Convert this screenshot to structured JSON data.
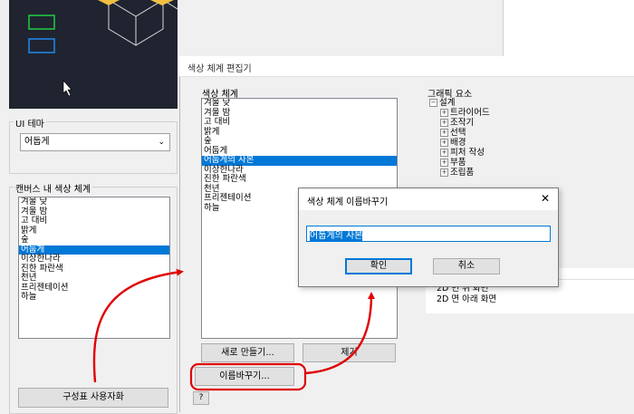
{
  "left_panel": {
    "ui_theme_label": "UI 테마",
    "ui_theme_value": "어둡게",
    "canvas_scheme_label": "캔버스 내 색상 체계",
    "schemes": [
      "겨울 낮",
      "겨울 밤",
      "고 대비",
      "밝게",
      "숲",
      "어둡게",
      "이상한나라",
      "진한 파란색",
      "천년",
      "프리젠테이션",
      "하늘"
    ],
    "selected_scheme": "어둡게",
    "bottom_button": "구성표 사용자화"
  },
  "editor": {
    "title": "색상 체계 편집기",
    "scheme_label": "색상 체계",
    "schemes": [
      "겨울 낮",
      "겨울 밤",
      "고 대비",
      "밝게",
      "숲",
      "어둡게",
      "어둡게의 사본",
      "이상한나라",
      "진한 파란색",
      "천년",
      "프리젠테이션",
      "하늘"
    ],
    "selected_scheme": "어둡게의 사본",
    "graphic_label": "그래픽 요소",
    "tree_root": "설계",
    "tree_children": [
      "트라이어드",
      "조작기",
      "선택",
      "배경",
      "피처 작성",
      "부품",
      "조립품"
    ],
    "tree_lower": [
      "2D 면 위 화면",
      "2D 면 아래 화면"
    ],
    "new_button": "새로 만들기...",
    "delete_button": "제거",
    "rename_button": "이름바꾸기...",
    "help_icon": "?"
  },
  "rename_dialog": {
    "title": "색상 체계 이름바꾸기",
    "value": "어둡게의 사본",
    "ok": "확인",
    "cancel": "취소",
    "close": "✕"
  },
  "colors": {
    "selection": "#0078d7",
    "annotation": "#e00000",
    "preview_bg": "#1f2430",
    "grid_line": "#d9d9d9",
    "cube_face": "#f0c040"
  }
}
